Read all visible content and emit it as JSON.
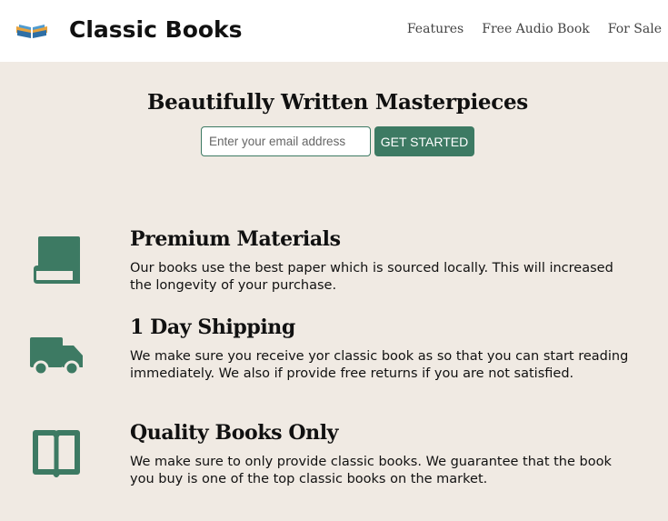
{
  "header": {
    "brand": "Classic Books",
    "logo_icon": "open-book-logo-icon",
    "nav": [
      {
        "label": "Features"
      },
      {
        "label": "Free Audio Book"
      },
      {
        "label": "For Sale"
      }
    ]
  },
  "hero": {
    "title": "Beautifully Written Masterpieces",
    "email_placeholder": "Enter your email address",
    "cta_label": "GET STARTED"
  },
  "features": [
    {
      "icon": "book-icon",
      "title": "Premium Materials",
      "text": "Our books use the best paper which is sourced locally. This will increased the longevity of your purchase."
    },
    {
      "icon": "truck-icon",
      "title": "1 Day Shipping",
      "text": "We make sure you receive yor classic book as so that you can start reading immediately. We also if provide free returns if you are not satisfied."
    },
    {
      "icon": "open-book-icon",
      "title": "Quality Books Only",
      "text": "We make sure to only provide classic books. We guarantee that the book you buy is one of the top classic books on the market."
    }
  ],
  "colors": {
    "accent": "#3d7a63",
    "background": "#f0eae3",
    "header_bg": "#ffffff"
  }
}
